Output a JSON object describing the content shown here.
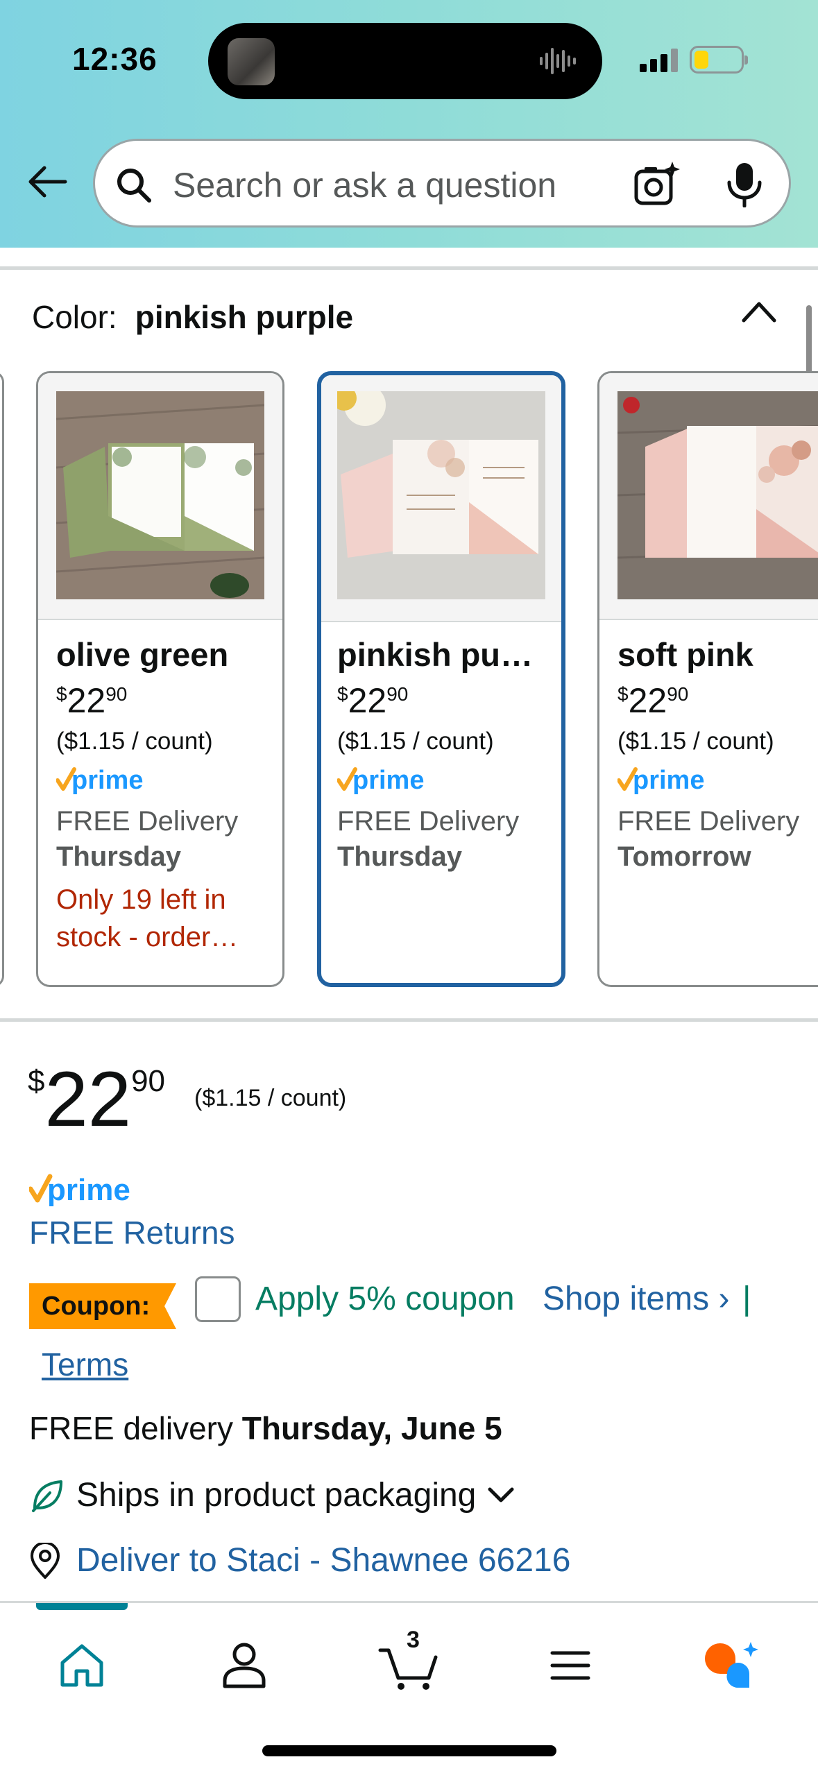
{
  "status_bar": {
    "time": "12:36"
  },
  "search": {
    "placeholder": "Search or ask a question"
  },
  "color_selector": {
    "label": "Color:",
    "selected_value": "pinkish purple",
    "options": [
      {
        "name": "olive green",
        "currency": "$",
        "price_whole": "22",
        "price_fraction": "90",
        "unit_price": "($1.15 / count)",
        "delivery": "FREE Delivery",
        "delivery_day": "Thursday",
        "stock_note_line1": "Only 19 left in",
        "stock_note_line2": "stock - order…"
      },
      {
        "name": "pinkish pu…",
        "currency": "$",
        "price_whole": "22",
        "price_fraction": "90",
        "unit_price": "($1.15 / count)",
        "delivery": "FREE Delivery",
        "delivery_day": "Thursday"
      },
      {
        "name": "soft pink",
        "currency": "$",
        "price_whole": "22",
        "price_fraction": "90",
        "unit_price": "($1.15 / count)",
        "delivery": "FREE Delivery",
        "delivery_day": "Tomorrow"
      }
    ]
  },
  "price": {
    "currency": "$",
    "whole": "22",
    "fraction": "90",
    "unit_price": "($1.15 / count)"
  },
  "returns": "FREE Returns",
  "coupon": {
    "badge": "Coupon:",
    "apply_text": "Apply 5% coupon",
    "shop_items": "Shop items ›",
    "separator": "|",
    "terms": "Terms"
  },
  "delivery": {
    "prefix": "FREE delivery",
    "date": "Thursday, June 5"
  },
  "packaging": "Ships in product packaging",
  "deliver_to": "Deliver to Staci - Shawnee 66216",
  "tabbar": {
    "cart_count": "3",
    "items": [
      "home-icon",
      "account-icon",
      "cart-icon",
      "menu-icon",
      "rufus-icon"
    ]
  },
  "colors": {
    "accent_blue": "#2162a1",
    "prime_blue": "#1a98ff",
    "prime_check": "#f7a51e",
    "coupon_orange": "#ff9900",
    "coupon_green": "#067d62",
    "stock_red": "#b12704",
    "tab_teal": "#008296"
  }
}
